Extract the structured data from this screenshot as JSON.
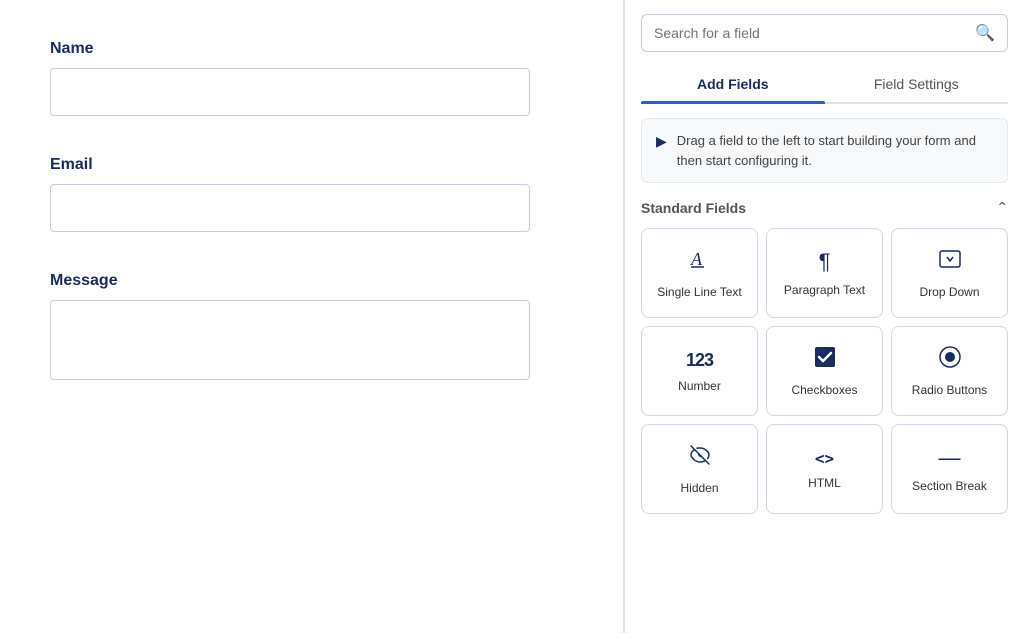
{
  "search": {
    "placeholder": "Search for a field"
  },
  "tabs": [
    {
      "id": "add-fields",
      "label": "Add Fields",
      "active": true
    },
    {
      "id": "field-settings",
      "label": "Field Settings",
      "active": false
    }
  ],
  "info": {
    "text": "Drag a field to the left to start building your form and then start configuring it."
  },
  "standard_fields": {
    "title": "Standard Fields",
    "items": [
      {
        "id": "single-line-text",
        "label": "Single Line Text",
        "icon": "A"
      },
      {
        "id": "paragraph-text",
        "label": "Paragraph Text",
        "icon": "¶"
      },
      {
        "id": "drop-down",
        "label": "Drop Down",
        "icon": "▣"
      },
      {
        "id": "number",
        "label": "Number",
        "icon": "123"
      },
      {
        "id": "checkboxes",
        "label": "Checkboxes",
        "icon": "☑"
      },
      {
        "id": "radio-buttons",
        "label": "Radio Buttons",
        "icon": "◉"
      },
      {
        "id": "hidden",
        "label": "Hidden",
        "icon": "👁"
      },
      {
        "id": "html",
        "label": "HTML",
        "icon": "<>"
      },
      {
        "id": "section-break",
        "label": "Section Break",
        "icon": "—"
      }
    ]
  },
  "form": {
    "fields": [
      {
        "id": "name",
        "label": "Name",
        "type": "input"
      },
      {
        "id": "email",
        "label": "Email",
        "type": "input"
      },
      {
        "id": "message",
        "label": "Message",
        "type": "textarea"
      }
    ]
  }
}
